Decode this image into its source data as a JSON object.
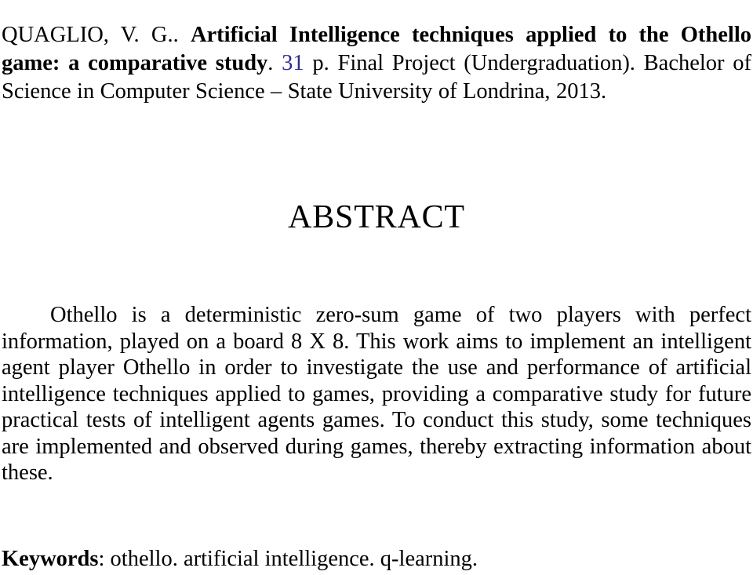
{
  "document": {
    "type": "thesis-abstract-page",
    "citation": {
      "author": "QUAGLIO, V. G.. ",
      "work_title": "Artificial Intelligence techniques applied to the Othello game: a comparative study",
      "after_title_punctuation": ". ",
      "page_count": "31",
      "page_count_color": "#2b2b8f",
      "publication_details": " p. Final Project (Undergraduation). Bachelor of Science in Computer Science – State University of Londrina, 2013."
    },
    "heading": "ABSTRACT",
    "abstract_text": "Othello is a deterministic zero-sum game of two players with perfect information, played on a board 8 X 8. This work aims to implement an intelligent agent player Othello in order to investigate the use and performance of artificial intelligence techniques applied to games, providing a comparative study for future practical tests of intelligent agents games. To conduct this study, some techniques are implemented and observed during games, thereby extracting information about these.",
    "keywords": {
      "label": "Keywords",
      "separator": ": ",
      "list": "othello. artificial intelligence. q-learning."
    }
  }
}
